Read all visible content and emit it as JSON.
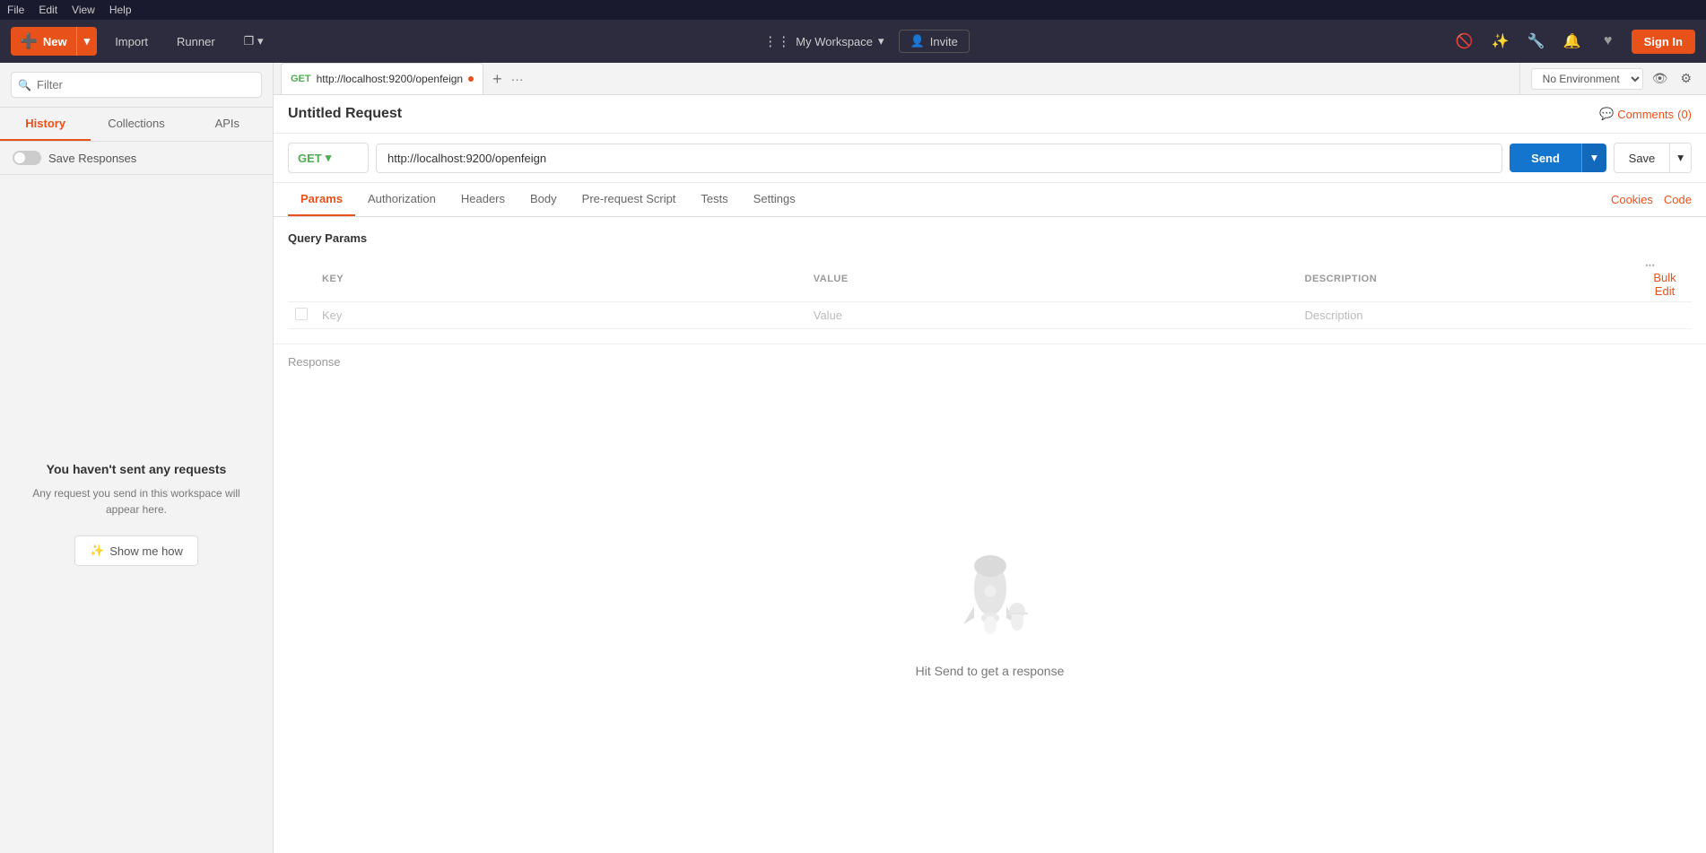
{
  "menuBar": {
    "items": [
      "File",
      "Edit",
      "View",
      "Help"
    ]
  },
  "toolbar": {
    "newLabel": "New",
    "importLabel": "Import",
    "runnerLabel": "Runner",
    "workspaceName": "My Workspace",
    "inviteLabel": "Invite",
    "signInLabel": "Sign In"
  },
  "sidebar": {
    "searchPlaceholder": "Filter",
    "tabs": [
      {
        "id": "history",
        "label": "History"
      },
      {
        "id": "collections",
        "label": "Collections"
      },
      {
        "id": "apis",
        "label": "APIs"
      }
    ],
    "saveResponsesLabel": "Save Responses",
    "emptyTitle": "You haven't sent any requests",
    "emptyText": "Any request you send in this workspace will appear here.",
    "showMeHowLabel": "Show me how"
  },
  "requestTab": {
    "method": "GET",
    "url": "http://localhost:9200/openfeign",
    "isDirty": true,
    "title": "Untitled Request"
  },
  "tabs": {
    "plus": "+",
    "more": "···"
  },
  "environment": {
    "label": "No Environment",
    "eyeIcon": "👁",
    "gearIcon": "⚙"
  },
  "comments": {
    "label": "Comments",
    "count": "(0)"
  },
  "urlBar": {
    "method": "GET",
    "url": "http://localhost:9200/openfeign",
    "sendLabel": "Send",
    "saveLabel": "Save"
  },
  "requestTabs": [
    {
      "id": "params",
      "label": "Params"
    },
    {
      "id": "authorization",
      "label": "Authorization"
    },
    {
      "id": "headers",
      "label": "Headers"
    },
    {
      "id": "body",
      "label": "Body"
    },
    {
      "id": "prerequest",
      "label": "Pre-request Script"
    },
    {
      "id": "tests",
      "label": "Tests"
    },
    {
      "id": "settings",
      "label": "Settings"
    }
  ],
  "rightLinks": [
    {
      "id": "cookies",
      "label": "Cookies"
    },
    {
      "id": "code",
      "label": "Code"
    }
  ],
  "paramsTable": {
    "title": "Query Params",
    "columns": [
      "KEY",
      "VALUE",
      "DESCRIPTION"
    ],
    "bulkEditLabel": "Bulk Edit",
    "keyPlaceholder": "Key",
    "valuePlaceholder": "Value",
    "descPlaceholder": "Description"
  },
  "response": {
    "sectionLabel": "Response",
    "hint": "Hit Send to get a response"
  }
}
